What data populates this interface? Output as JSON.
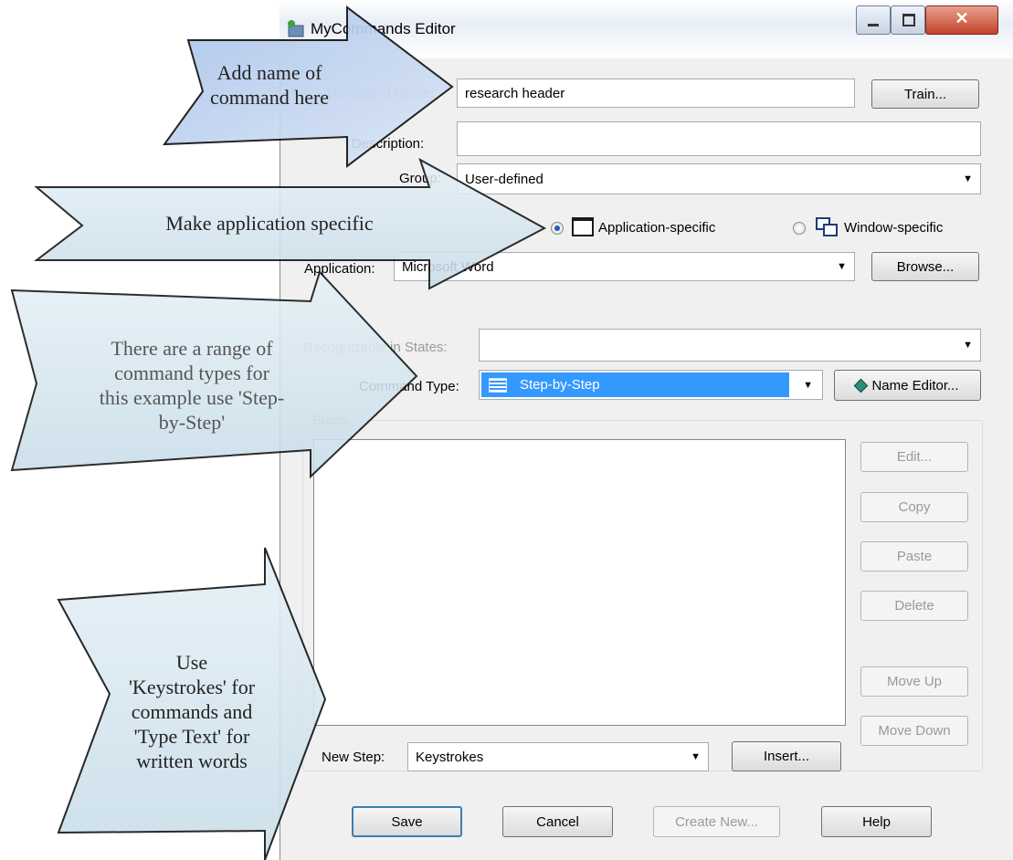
{
  "window": {
    "title": "MyCommands Editor",
    "controls": {
      "minimize": "minimize-icon",
      "maximize": "maximize-icon",
      "close": "close-icon"
    }
  },
  "form": {
    "command_name": {
      "label": "Command Name:",
      "value": "research header"
    },
    "train_button": "Train...",
    "description": {
      "label": "Description:",
      "value": ""
    },
    "group": {
      "label": "Group:",
      "value": "User-defined"
    },
    "scope": {
      "application_specific": {
        "label": "Application-specific",
        "selected": true
      },
      "window_specific": {
        "label": "Window-specific",
        "selected": false
      }
    },
    "application": {
      "label": "Application:",
      "value": "Microsoft Word"
    },
    "browse_button": "Browse...",
    "recognizable": {
      "label": "Recognizable in States:",
      "value": ""
    },
    "command_type": {
      "label": "Command Type:",
      "value": "Step-by-Step"
    },
    "name_editor_button": "Name Editor...",
    "steps": {
      "label": "Steps:"
    },
    "side_buttons": {
      "edit": "Edit...",
      "copy": "Copy",
      "paste": "Paste",
      "delete": "Delete",
      "move_up": "Move Up",
      "move_down": "Move Down"
    },
    "new_step": {
      "label": "New Step:",
      "value": "Keystrokes"
    },
    "insert_button": "Insert...",
    "footer": {
      "save": "Save",
      "cancel": "Cancel",
      "create_new": "Create New...",
      "help": "Help"
    }
  },
  "callouts": {
    "name": [
      "Add name of",
      "command here"
    ],
    "app": [
      "Make application specific"
    ],
    "type": [
      "There are a range of",
      "command types for",
      "this example use 'Step-",
      "by-Step'"
    ],
    "keys": [
      "Use",
      "'Keystrokes' for",
      "commands and",
      "'Type Text' for",
      "written words"
    ]
  },
  "colors": {
    "selection": "#3399ff",
    "callout_fill": "#cfe0ee",
    "callout_fill_top": "#b8cdea"
  }
}
